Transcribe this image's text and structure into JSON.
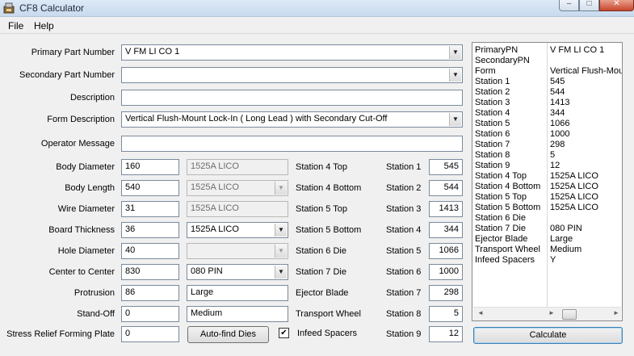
{
  "window": {
    "title": "CF8 Calculator",
    "minimize_glyph": "–",
    "maximize_glyph": "□",
    "close_glyph": "✕"
  },
  "menu": {
    "file": "File",
    "help": "Help"
  },
  "form": {
    "primary_label": "Primary Part Number",
    "primary_value": "V FM LI CO 1",
    "secondary_label": "Secondary Part Number",
    "secondary_value": "",
    "description_label": "Description",
    "description_value": "",
    "formdesc_label": "Form Description",
    "formdesc_value": "Vertical Flush-Mount Lock-In ( Long Lead ) with Secondary Cut-Off",
    "opmsg_label": "Operator Message",
    "opmsg_value": ""
  },
  "params": [
    {
      "label": "Body Diameter",
      "value": "160"
    },
    {
      "label": "Body Length",
      "value": "540"
    },
    {
      "label": "Wire Diameter",
      "value": "31"
    },
    {
      "label": "Board Thickness",
      "value": "36"
    },
    {
      "label": "Hole Diameter",
      "value": "40"
    },
    {
      "label": "Center to Center",
      "value": "830"
    },
    {
      "label": "Protrusion",
      "value": "86"
    },
    {
      "label": "Stand-Off",
      "value": "0"
    },
    {
      "label": "Stress Relief Forming Plate",
      "value": "0"
    }
  ],
  "dies": [
    {
      "value": "1525A LICO",
      "label": "Station 4 Top"
    },
    {
      "value": "1525A LICO",
      "label": "Station 4 Bottom"
    },
    {
      "value": "1525A LICO",
      "label": "Station 5 Top"
    },
    {
      "value": "1525A LICO",
      "label": "Station 5 Bottom"
    },
    {
      "value": "",
      "label": "Station 6 Die"
    },
    {
      "value": "080 PIN",
      "label": "Station 7 Die"
    },
    {
      "value": "Large",
      "label": "Ejector Blade"
    },
    {
      "value": "Medium",
      "label": "Transport Wheel"
    }
  ],
  "autofind_label": "Auto-find Dies",
  "infeed": {
    "label": "Infeed Spacers",
    "checked": "✔"
  },
  "stations": [
    {
      "label": "Station 1",
      "value": "545"
    },
    {
      "label": "Station 2",
      "value": "544"
    },
    {
      "label": "Station 3",
      "value": "1413"
    },
    {
      "label": "Station 4",
      "value": "344"
    },
    {
      "label": "Station 5",
      "value": "1066"
    },
    {
      "label": "Station 6",
      "value": "1000"
    },
    {
      "label": "Station 7",
      "value": "298"
    },
    {
      "label": "Station 8",
      "value": "5"
    },
    {
      "label": "Station 9",
      "value": "12"
    }
  ],
  "summary": [
    {
      "key": "PrimaryPN",
      "val": "V FM LI CO 1"
    },
    {
      "key": "SecondaryPN",
      "val": ""
    },
    {
      "key": "Form",
      "val": "Vertical Flush-Mount"
    },
    {
      "key": "Station 1",
      "val": "545"
    },
    {
      "key": "Station 2",
      "val": "544"
    },
    {
      "key": "Station 3",
      "val": "1413"
    },
    {
      "key": "Station 4",
      "val": "344"
    },
    {
      "key": "Station 5",
      "val": "1066"
    },
    {
      "key": "Station 6",
      "val": "1000"
    },
    {
      "key": "Station 7",
      "val": "298"
    },
    {
      "key": "Station 8",
      "val": "5"
    },
    {
      "key": "Station 9",
      "val": "12"
    },
    {
      "key": "Station 4 Top",
      "val": "1525A LICO"
    },
    {
      "key": "Station 4 Bottom",
      "val": "1525A LICO"
    },
    {
      "key": "Station 5 Top",
      "val": "1525A LICO"
    },
    {
      "key": "Station 5 Bottom",
      "val": "1525A LICO"
    },
    {
      "key": "Station 6 Die",
      "val": ""
    },
    {
      "key": "Station 7 Die",
      "val": "080 PIN"
    },
    {
      "key": "Ejector Blade",
      "val": "Large"
    },
    {
      "key": "Transport Wheel",
      "val": "Medium"
    },
    {
      "key": "Infeed Spacers",
      "val": "Y"
    }
  ],
  "scroll": {
    "left": "◄",
    "right": "►"
  },
  "calculate_label": "Calculate"
}
